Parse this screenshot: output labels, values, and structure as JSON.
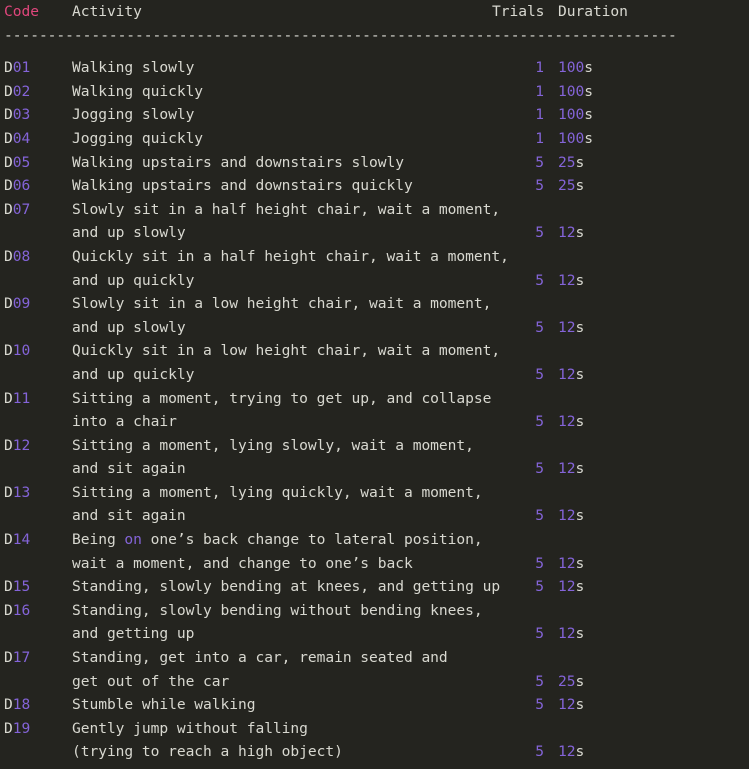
{
  "theme": {
    "background": "#24241f",
    "text": "#d8d8d0",
    "number": "#8464d8",
    "keyword": "#8464d8",
    "header_code": "#e0467c"
  },
  "header": {
    "code": "Code",
    "activity": "Activity",
    "trials": "Trials",
    "duration": "Duration"
  },
  "separator": "-----------------------------------------------------------------------------",
  "rows": [
    {
      "code_letter": "D",
      "code_number": "01",
      "lines": [
        "Walking slowly"
      ],
      "trials": "1",
      "duration_value": "100",
      "duration_unit": "s"
    },
    {
      "code_letter": "D",
      "code_number": "02",
      "lines": [
        "Walking quickly"
      ],
      "trials": "1",
      "duration_value": "100",
      "duration_unit": "s"
    },
    {
      "code_letter": "D",
      "code_number": "03",
      "lines": [
        "Jogging slowly"
      ],
      "trials": "1",
      "duration_value": "100",
      "duration_unit": "s"
    },
    {
      "code_letter": "D",
      "code_number": "04",
      "lines": [
        "Jogging quickly"
      ],
      "trials": "1",
      "duration_value": "100",
      "duration_unit": "s"
    },
    {
      "code_letter": "D",
      "code_number": "05",
      "lines": [
        "Walking upstairs and downstairs slowly"
      ],
      "trials": "5",
      "duration_value": "25",
      "duration_unit": "s"
    },
    {
      "code_letter": "D",
      "code_number": "06",
      "lines": [
        "Walking upstairs and downstairs quickly"
      ],
      "trials": "5",
      "duration_value": "25",
      "duration_unit": "s"
    },
    {
      "code_letter": "D",
      "code_number": "07",
      "lines": [
        "Slowly sit in a half height chair, wait a moment,",
        "and up slowly"
      ],
      "trials": "5",
      "duration_value": "12",
      "duration_unit": "s"
    },
    {
      "code_letter": "D",
      "code_number": "08",
      "lines": [
        "Quickly sit in a half height chair, wait a moment,",
        "and up quickly"
      ],
      "trials": "5",
      "duration_value": "12",
      "duration_unit": "s"
    },
    {
      "code_letter": "D",
      "code_number": "09",
      "lines": [
        "Slowly sit in a low height chair, wait a moment,",
        "and up slowly"
      ],
      "trials": "5",
      "duration_value": "12",
      "duration_unit": "s"
    },
    {
      "code_letter": "D",
      "code_number": "10",
      "lines": [
        "Quickly sit in a low height chair, wait a moment,",
        "and up quickly"
      ],
      "trials": "5",
      "duration_value": "12",
      "duration_unit": "s"
    },
    {
      "code_letter": "D",
      "code_number": "11",
      "lines": [
        "Sitting a moment, trying to get up, and collapse",
        "into a chair"
      ],
      "trials": "5",
      "duration_value": "12",
      "duration_unit": "s"
    },
    {
      "code_letter": "D",
      "code_number": "12",
      "lines": [
        "Sitting a moment, lying slowly, wait a moment,",
        "and sit again"
      ],
      "trials": "5",
      "duration_value": "12",
      "duration_unit": "s"
    },
    {
      "code_letter": "D",
      "code_number": "13",
      "lines": [
        "Sitting a moment, lying quickly, wait a moment,",
        "and sit again"
      ],
      "trials": "5",
      "duration_value": "12",
      "duration_unit": "s"
    },
    {
      "code_letter": "D",
      "code_number": "14",
      "lines": [
        "Being on one’s back change to lateral position,",
        "wait a moment, and change to one’s back"
      ],
      "keyword": "on",
      "trials": "5",
      "duration_value": "12",
      "duration_unit": "s"
    },
    {
      "code_letter": "D",
      "code_number": "15",
      "lines": [
        "Standing, slowly bending at knees, and getting up"
      ],
      "trials": "5",
      "duration_value": "12",
      "duration_unit": "s"
    },
    {
      "code_letter": "D",
      "code_number": "16",
      "lines": [
        "Standing, slowly bending without bending knees,",
        "and getting up"
      ],
      "trials": "5",
      "duration_value": "12",
      "duration_unit": "s"
    },
    {
      "code_letter": "D",
      "code_number": "17",
      "lines": [
        "Standing, get into a car, remain seated and",
        "get out of the car"
      ],
      "trials": "5",
      "duration_value": "25",
      "duration_unit": "s"
    },
    {
      "code_letter": "D",
      "code_number": "18",
      "lines": [
        "Stumble while walking"
      ],
      "trials": "5",
      "duration_value": "12",
      "duration_unit": "s"
    },
    {
      "code_letter": "D",
      "code_number": "19",
      "lines": [
        "Gently jump without falling",
        "(trying to reach a high object)"
      ],
      "trials": "5",
      "duration_value": "12",
      "duration_unit": "s"
    }
  ]
}
